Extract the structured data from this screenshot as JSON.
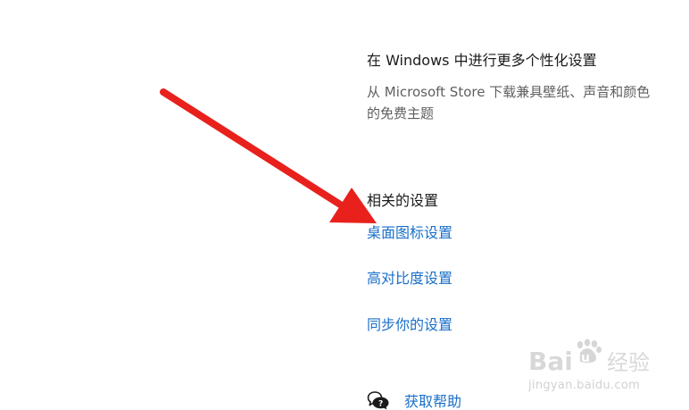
{
  "personalize": {
    "title": "在 Windows 中进行更多个性化设置",
    "description": "从 Microsoft Store 下载兼具壁纸、声音和颜色的免费主题"
  },
  "related_settings": {
    "heading": "相关的设置",
    "links": [
      "桌面图标设置",
      "高对比度设置",
      "同步你的设置"
    ]
  },
  "help": {
    "label": "获取帮助",
    "icon": "chat-help-icon"
  },
  "annotation": {
    "icon": "red-arrow",
    "color": "#e8211c"
  },
  "watermark": {
    "logo": "Bai du 经验",
    "url": "jingyan.baidu.com"
  },
  "colors": {
    "link": "#1a6fc9",
    "text": "#1a1a1a",
    "secondary_text": "#5f5f5f",
    "background": "#ffffff"
  }
}
